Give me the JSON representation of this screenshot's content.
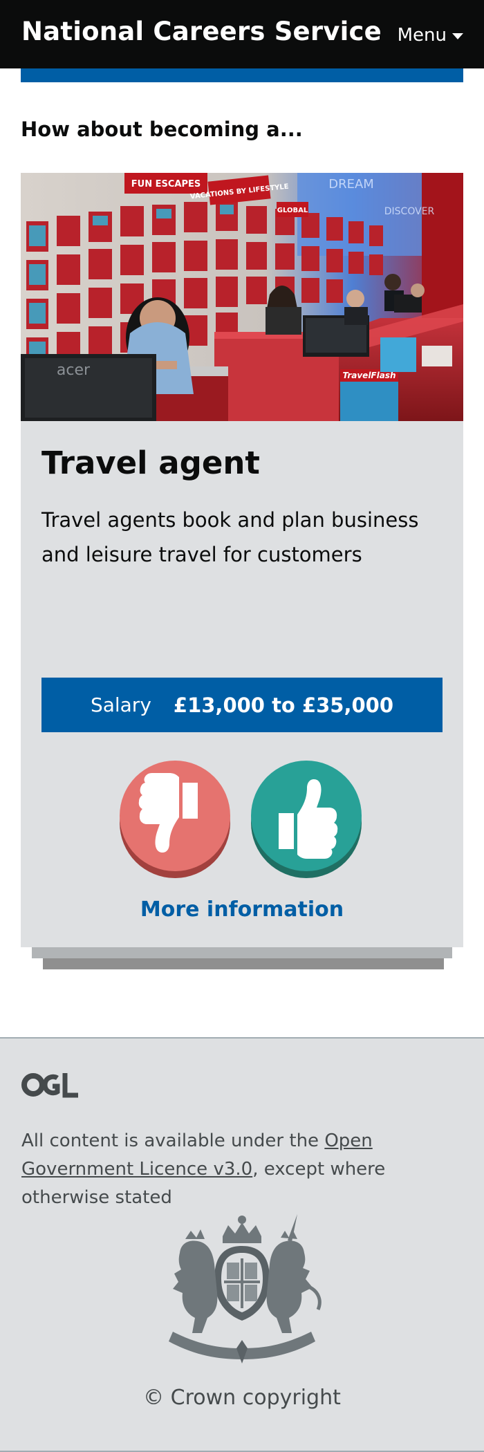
{
  "header": {
    "brand": "National Careers Service",
    "menu_label": "Menu"
  },
  "intro": {
    "heading": "How about becoming a..."
  },
  "card": {
    "image_icon": "travel-agency-photo",
    "title": "Travel agent",
    "description": "Travel agents book and plan business and leisure travel for customers",
    "salary_label": "Salary",
    "salary_value": "£13,000 to £35,000",
    "dislike_icon": "thumbs-down-icon",
    "like_icon": "thumbs-up-icon",
    "more_info": "More information",
    "image_signs": [
      "FUN ESCAPES",
      "VACATIONS BY LIFESTYLE",
      "GLOBAL",
      "DREAM",
      "DISCOVER",
      "acer",
      "TravelFlash"
    ]
  },
  "footer": {
    "ogl_logo": "OGL",
    "licence_prefix": "All content is available under the ",
    "licence_link": "Open Government Licence v3.0",
    "licence_suffix": ", except where otherwise stated",
    "crest_icon": "royal-coat-of-arms-icon",
    "copyright": "© Crown copyright"
  },
  "colors": {
    "header_bg": "#0b0c0c",
    "brand_blue": "#005ea5",
    "card_bg": "#dee0e2",
    "dislike": "#e5736f",
    "like": "#28a197"
  }
}
